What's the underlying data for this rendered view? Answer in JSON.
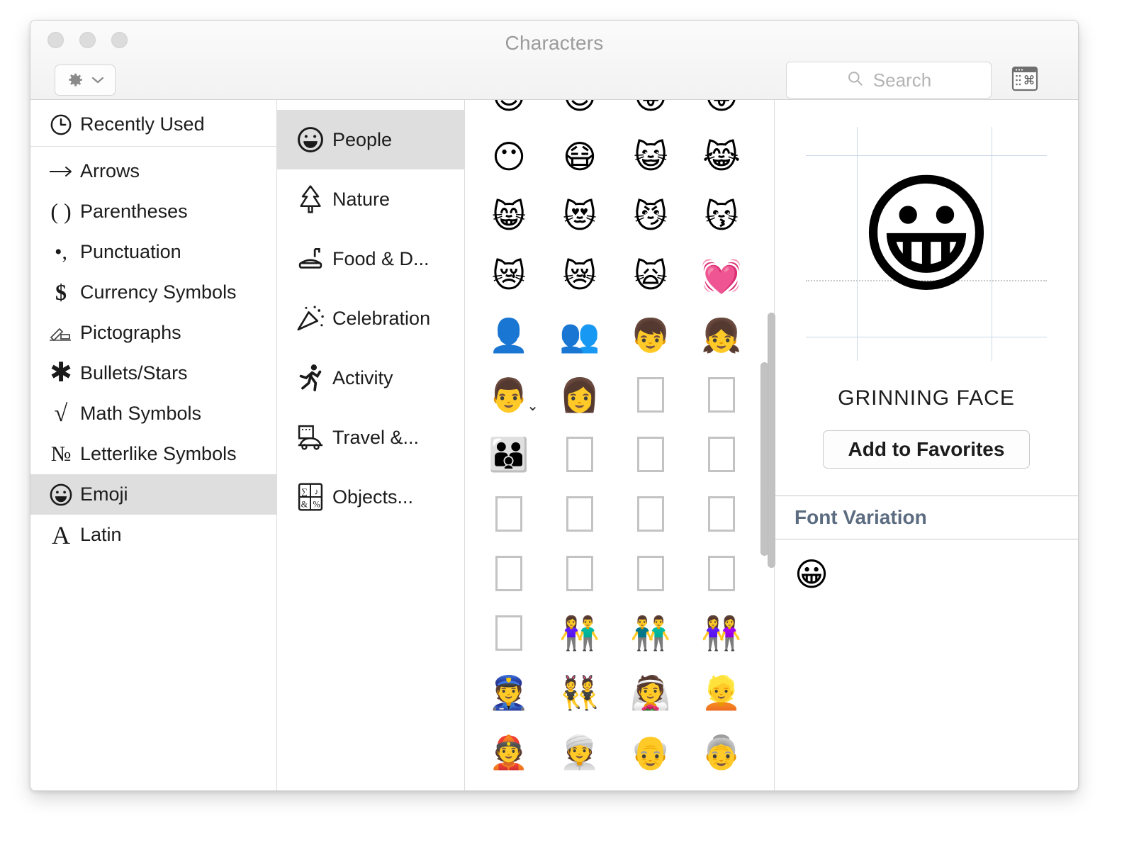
{
  "window": {
    "title": "Characters",
    "traffic_lights": [
      "close",
      "minimize",
      "zoom"
    ],
    "gear_button_label": "gear-menu",
    "panel_toggle_label": "input-sources-panel"
  },
  "search": {
    "placeholder": "Search",
    "value": "",
    "icon": "search-icon"
  },
  "sidebar": {
    "recently_used": {
      "label": "Recently Used",
      "icon": "clock-icon"
    },
    "items": [
      {
        "label": "Arrows",
        "icon": "arrow-right-icon",
        "glyph": "⟶",
        "selected": false
      },
      {
        "label": "Parentheses",
        "icon": "parentheses-icon",
        "glyph": "( )",
        "selected": false
      },
      {
        "label": "Punctuation",
        "icon": "punctuation-icon",
        "glyph": "•,",
        "selected": false
      },
      {
        "label": "Currency Symbols",
        "icon": "dollar-icon",
        "glyph": "$",
        "selected": false
      },
      {
        "label": "Pictographs",
        "icon": "pictograph-icon",
        "glyph": "✍",
        "selected": false
      },
      {
        "label": "Bullets/Stars",
        "icon": "asterisk-icon",
        "glyph": "✳",
        "selected": false
      },
      {
        "label": "Math Symbols",
        "icon": "radical-icon",
        "glyph": "√",
        "selected": false
      },
      {
        "label": "Letterlike Symbols",
        "icon": "numero-icon",
        "glyph": "№",
        "selected": false
      },
      {
        "label": "Emoji",
        "icon": "smiley-icon",
        "glyph": "☺",
        "selected": true
      },
      {
        "label": "Latin",
        "icon": "letter-a-icon",
        "glyph": "A",
        "selected": false
      }
    ]
  },
  "categories": [
    {
      "label": "People",
      "icon": "grinning-face-icon",
      "glyph": "☺",
      "selected": true
    },
    {
      "label": "Nature",
      "icon": "evergreen-tree-icon",
      "glyph": "🌲",
      "selected": false
    },
    {
      "label": "Food & D...",
      "icon": "food-icon",
      "glyph": "🍔",
      "selected": false
    },
    {
      "label": "Celebration",
      "icon": "party-popper-icon",
      "glyph": "🎉",
      "selected": false
    },
    {
      "label": "Activity",
      "icon": "runner-icon",
      "glyph": "🏃",
      "selected": false
    },
    {
      "label": "Travel &...",
      "icon": "travel-icon",
      "glyph": "🚕",
      "selected": false
    },
    {
      "label": "Objects...",
      "icon": "objects-symbols-icon",
      "glyph": "🔣",
      "selected": false
    }
  ],
  "grid": {
    "columns": 4,
    "scrollbar": {
      "thumb_top_pct": 38,
      "thumb_height_pct": 28
    },
    "cells": [
      {
        "glyph": "😊",
        "name": "smiling-face",
        "missing": false,
        "partial": true
      },
      {
        "glyph": "😌",
        "name": "relieved-face",
        "missing": false,
        "partial": true
      },
      {
        "glyph": "😛",
        "name": "face-with-tongue",
        "missing": false,
        "partial": true
      },
      {
        "glyph": "😝",
        "name": "squinting-face-with-tongue",
        "missing": false,
        "partial": true
      },
      {
        "glyph": "😶",
        "name": "face-without-mouth",
        "missing": false
      },
      {
        "glyph": "😷",
        "name": "face-with-medical-mask",
        "missing": false
      },
      {
        "glyph": "😺",
        "name": "grinning-cat",
        "missing": false
      },
      {
        "glyph": "😹",
        "name": "cat-with-tears-of-joy",
        "missing": false
      },
      {
        "glyph": "😸",
        "name": "grinning-cat-with-smiling-eyes",
        "missing": false
      },
      {
        "glyph": "😻",
        "name": "smiling-cat-with-heart-eyes",
        "missing": false
      },
      {
        "glyph": "😼",
        "name": "cat-with-wry-smile",
        "missing": false
      },
      {
        "glyph": "😽",
        "name": "kissing-cat",
        "missing": false
      },
      {
        "glyph": "😿",
        "name": "crying-cat",
        "missing": false
      },
      {
        "glyph": "😿",
        "name": "weary-crying-cat",
        "missing": false
      },
      {
        "glyph": "🙀",
        "name": "weary-cat",
        "missing": false
      },
      {
        "glyph": "💓",
        "name": "beating-heart",
        "missing": false
      },
      {
        "glyph": "👤",
        "name": "bust-in-silhouette",
        "missing": false
      },
      {
        "glyph": "👥",
        "name": "busts-in-silhouette",
        "missing": false
      },
      {
        "glyph": "👦",
        "name": "boy",
        "missing": false
      },
      {
        "glyph": "👧",
        "name": "girl",
        "missing": false
      },
      {
        "glyph": "👨",
        "name": "man",
        "missing": false,
        "variants": true
      },
      {
        "glyph": "👩",
        "name": "woman",
        "missing": false
      },
      {
        "glyph": "",
        "name": "missing-glyph",
        "missing": true
      },
      {
        "glyph": "",
        "name": "missing-glyph",
        "missing": true
      },
      {
        "glyph": "👪",
        "name": "family",
        "missing": false
      },
      {
        "glyph": "",
        "name": "missing-glyph",
        "missing": true
      },
      {
        "glyph": "",
        "name": "missing-glyph",
        "missing": true
      },
      {
        "glyph": "",
        "name": "missing-glyph",
        "missing": true
      },
      {
        "glyph": "",
        "name": "missing-glyph",
        "missing": true
      },
      {
        "glyph": "",
        "name": "missing-glyph",
        "missing": true
      },
      {
        "glyph": "",
        "name": "missing-glyph",
        "missing": true
      },
      {
        "glyph": "",
        "name": "missing-glyph",
        "missing": true
      },
      {
        "glyph": "",
        "name": "missing-glyph",
        "missing": true
      },
      {
        "glyph": "",
        "name": "missing-glyph",
        "missing": true
      },
      {
        "glyph": "",
        "name": "missing-glyph",
        "missing": true
      },
      {
        "glyph": "",
        "name": "missing-glyph",
        "missing": true
      },
      {
        "glyph": "",
        "name": "missing-glyph",
        "missing": true
      },
      {
        "glyph": "👫",
        "name": "woman-and-man-holding-hands",
        "missing": false
      },
      {
        "glyph": "👬",
        "name": "men-holding-hands",
        "missing": false
      },
      {
        "glyph": "👭",
        "name": "women-holding-hands",
        "missing": false
      },
      {
        "glyph": "👮",
        "name": "police-officer",
        "missing": false
      },
      {
        "glyph": "👯",
        "name": "people-with-bunny-ears",
        "missing": false
      },
      {
        "glyph": "👰",
        "name": "bride-with-veil",
        "missing": false
      },
      {
        "glyph": "👱",
        "name": "blond-haired-person",
        "missing": false
      },
      {
        "glyph": "👲",
        "name": "person-with-skullcap",
        "missing": false
      },
      {
        "glyph": "👳",
        "name": "person-wearing-turban",
        "missing": false
      },
      {
        "glyph": "👴",
        "name": "old-man",
        "missing": false
      },
      {
        "glyph": "👵",
        "name": "old-woman",
        "missing": false
      }
    ]
  },
  "preview": {
    "glyph": "😀",
    "character_name": "GRINNING FACE",
    "add_to_favorites_label": "Add to Favorites",
    "font_variation_title": "Font Variation",
    "font_variations": [
      {
        "glyph": "😀",
        "name": "grinning-face-variation"
      }
    ]
  },
  "colors": {
    "selection_gray": "#dedede",
    "title_gray": "#9b9b9b",
    "section_header_blue": "#5b6b80",
    "guide_blue": "#c9d8ea",
    "tofu_border": "#c3c3c3"
  }
}
